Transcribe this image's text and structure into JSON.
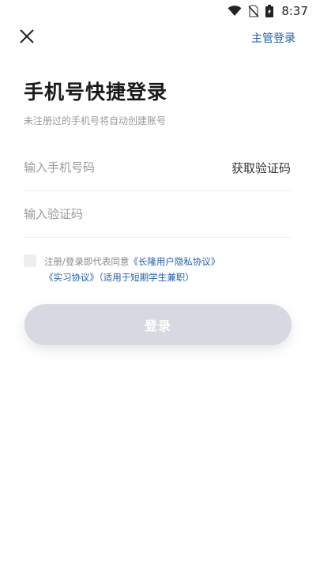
{
  "status_bar": {
    "time": "8:37",
    "icons": [
      "wifi-icon",
      "no-sim-icon",
      "battery-icon"
    ]
  },
  "nav": {
    "close_icon": "close-icon",
    "supervisor_login": "主管登录"
  },
  "header": {
    "title": "手机号快捷登录",
    "subtitle": "未注册过的手机号将自动创建账号"
  },
  "form": {
    "phone_placeholder": "输入手机号码",
    "phone_value": "",
    "get_code_label": "获取验证码",
    "code_placeholder": "输入验证码",
    "code_value": ""
  },
  "agreement": {
    "checked": false,
    "prefix": "注册/登录即代表同意",
    "privacy_link": "《长隆用户隐私协议》",
    "internship_link": "《实习协议》",
    "suffix": "（适用于短期学生兼职）"
  },
  "login_button": {
    "label": "登录"
  },
  "colors": {
    "link_blue": "#1f5fb0",
    "button_disabled": "#d6d9e1",
    "text_dark": "#1a1a1a",
    "text_muted": "#9a9a9a"
  }
}
